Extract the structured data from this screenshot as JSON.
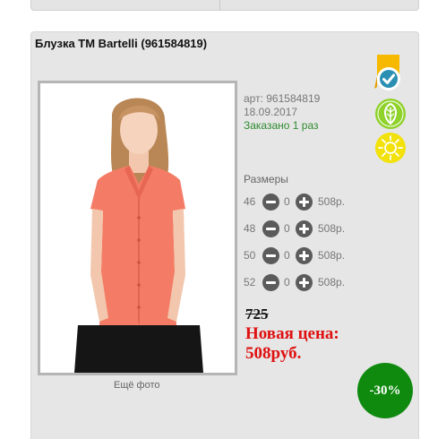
{
  "product": {
    "title": "Блузка ТМ Bartelli (961584819)",
    "article": "арт: 961584819",
    "date": "18.09.2017",
    "ordered": "Заказано 1 раз",
    "more_photo": "Ещё фото",
    "photo_alt": "Блузка ТМ Bartelli"
  },
  "badges": {
    "quality": "check-badge-icon",
    "eco": "leaf-icon",
    "summer": "sun-icon"
  },
  "sizes": {
    "heading": "Размеры",
    "items": [
      {
        "size": "46",
        "qty": "0",
        "price": "508р."
      },
      {
        "size": "48",
        "qty": "0",
        "price": "508р."
      },
      {
        "size": "50",
        "qty": "0",
        "price": "508р."
      },
      {
        "size": "52",
        "qty": "0",
        "price": "508р."
      }
    ]
  },
  "price": {
    "old": "725",
    "new_label": "Новая цена:",
    "new_value": "508руб."
  },
  "discount": "-30%",
  "colors": {
    "accent_green": "#0f8a0f",
    "price_red": "#e01010",
    "ordered_green": "#2e8b2e",
    "badge_gold": "#f6b900",
    "badge_lime": "#8fd22b",
    "badge_yellow": "#f2e10a"
  }
}
